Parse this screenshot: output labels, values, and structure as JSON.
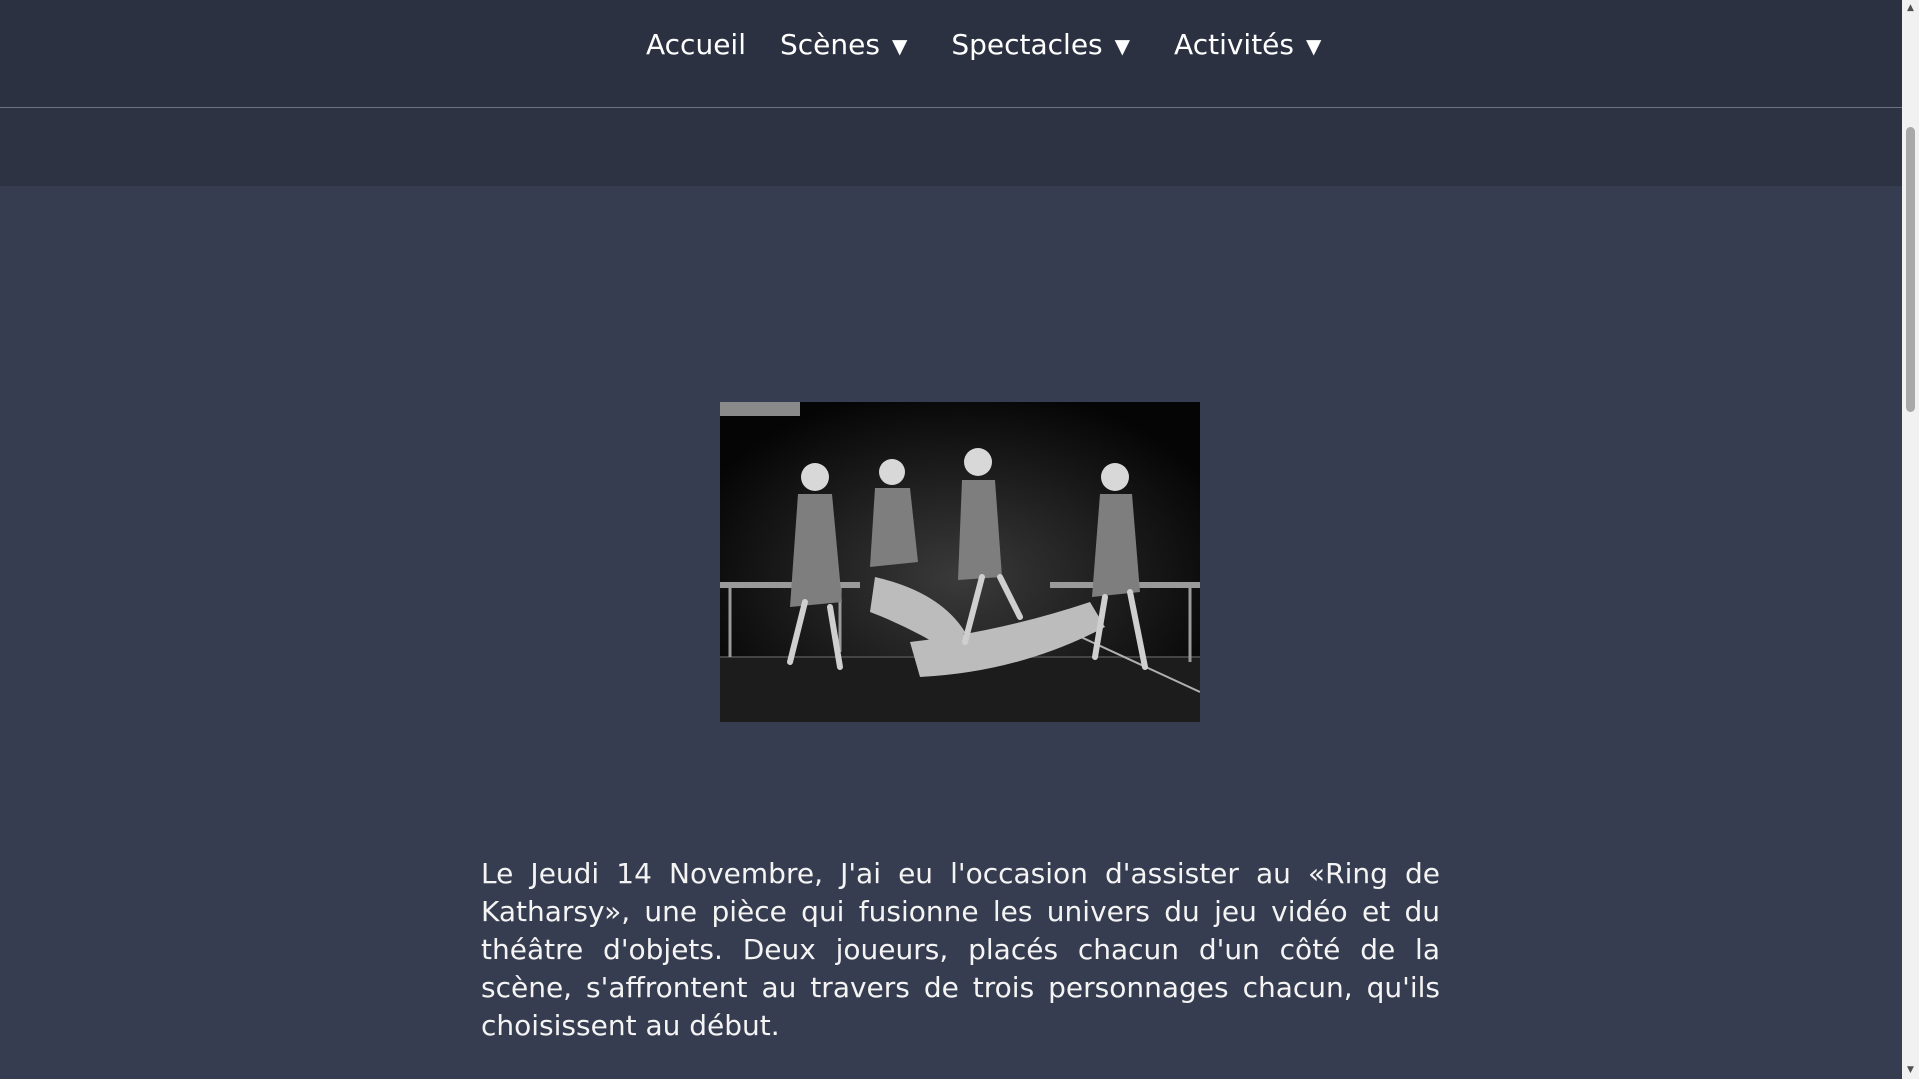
{
  "nav": {
    "items": [
      {
        "label": "Accueil",
        "has_dropdown": false
      },
      {
        "label": "Scènes",
        "has_dropdown": true
      },
      {
        "label": "Spectacles",
        "has_dropdown": true
      },
      {
        "label": "Activités",
        "has_dropdown": true
      }
    ],
    "caret": "▼"
  },
  "article": {
    "paragraph": "Le Jeudi 14 Novembre, J'ai eu l'occasion d'assister au «Ring de Katharsy», une pièce qui fusionne les univers du jeu vidéo et du théâtre d'objets. Deux joueurs, placés chacun d'un côté de la scène, s'affrontent au travers de trois personnages chacun, qu'ils choisissent au début."
  },
  "colors": {
    "header_bg": "#2c3142",
    "page_bg": "#373d50",
    "text": "#f4f4f4"
  },
  "icons": {
    "caret": "chevron-down-icon",
    "scroll_up": "arrow-up-icon",
    "scroll_down": "arrow-down-icon"
  }
}
